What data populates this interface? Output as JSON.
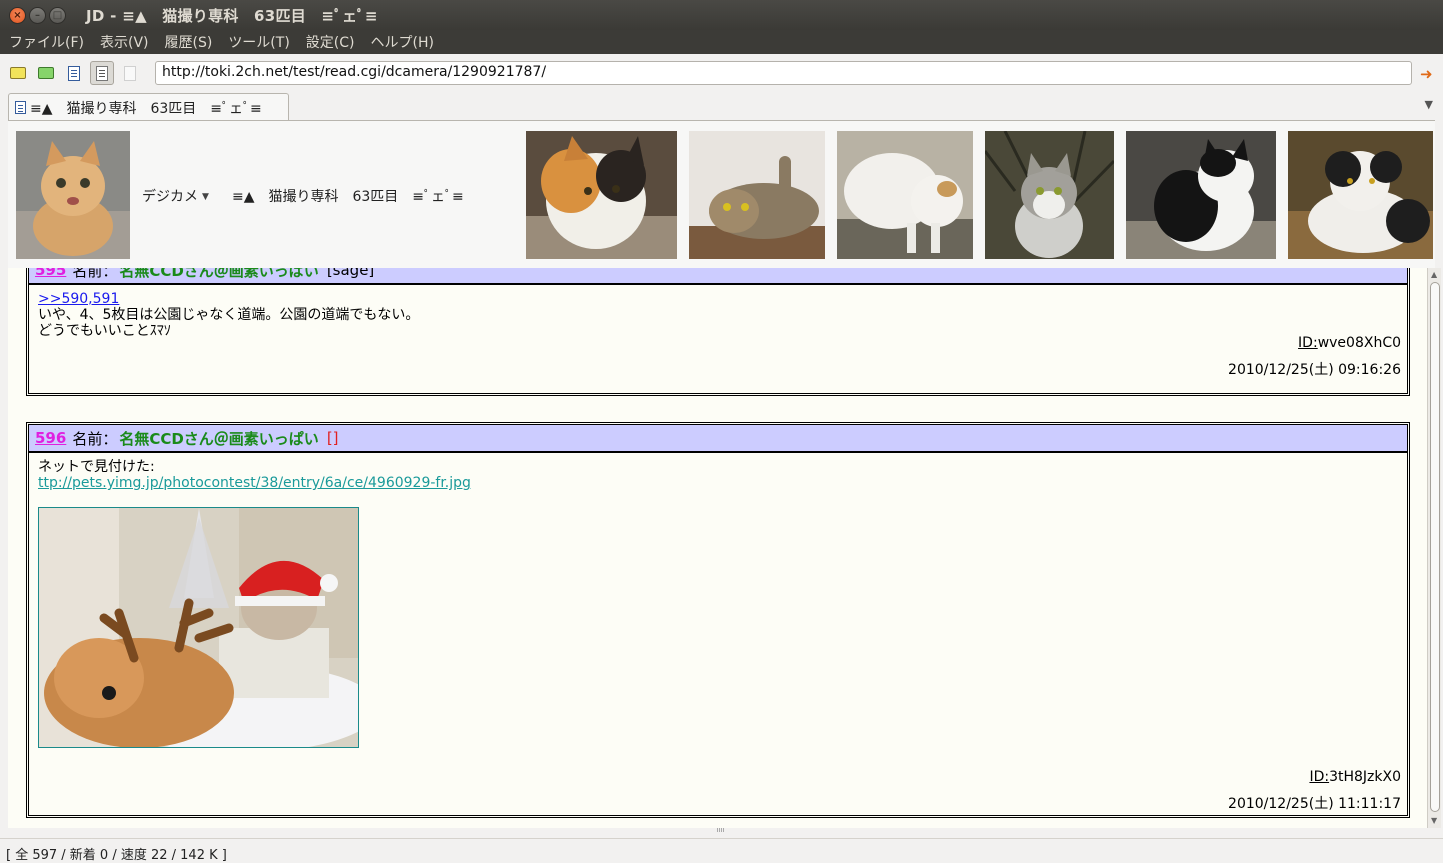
{
  "window": {
    "title": "JD - ≡▲　猫撮り専科　63匹目　≡ﾟェﾟ≡"
  },
  "menu": [
    "ファイル(F)",
    "表示(V)",
    "履歴(S)",
    "ツール(T)",
    "設定(C)",
    "ヘルプ(H)"
  ],
  "toolbar": {
    "url": "http://toki.2ch.net/test/read.cgi/dcamera/1290921787/",
    "icons": [
      "folder-icon",
      "green-folder-icon",
      "document-icon",
      "thread-icon",
      "image-icon",
      "go-icon"
    ]
  },
  "tab": {
    "label": "≡▲　猫撮り専科　63匹目　≡ﾟェﾟ≡"
  },
  "banner": {
    "board": "デジカメ",
    "thread_title": "≡▲　猫撮り専科　63匹目　≡ﾟェﾟ≡",
    "thumbnail_colors": [
      "#c99a6a",
      "#b07a46",
      "#a89a8a",
      "#c8c4be",
      "#6a6a5a",
      "#2a2a2a",
      "#3a3226"
    ]
  },
  "posts": [
    {
      "number": "595",
      "name_label": "名前：",
      "name": "名無CCDさん＠画素いっぱい",
      "mail": "[sage]",
      "anchor": ">>590,591",
      "lines": [
        "いや、4、5枚目は公園じゃなく道端。公園の道端でもない。",
        "どうでもいいことｽﾏｿ"
      ],
      "id_label": "ID:",
      "id": "wve08XhC0",
      "date": "2010/12/25(土) 09:16:26"
    },
    {
      "number": "596",
      "name_label": "名前：",
      "name": "名無CCDさん＠画素いっぱい",
      "mail": "[]",
      "text": "ネットで見付けた:",
      "link": "ttp://pets.yimg.jp/photocontest/38/entry/6a/ce/4960929-fr.jpg",
      "id_label": "ID:",
      "id": "3tH8JzkX0",
      "date": "2010/12/25(土) 11:11:17"
    }
  ],
  "status": {
    "text": "[ 全 597 / 新着 0 / 速度 22 / 142 K ]"
  }
}
